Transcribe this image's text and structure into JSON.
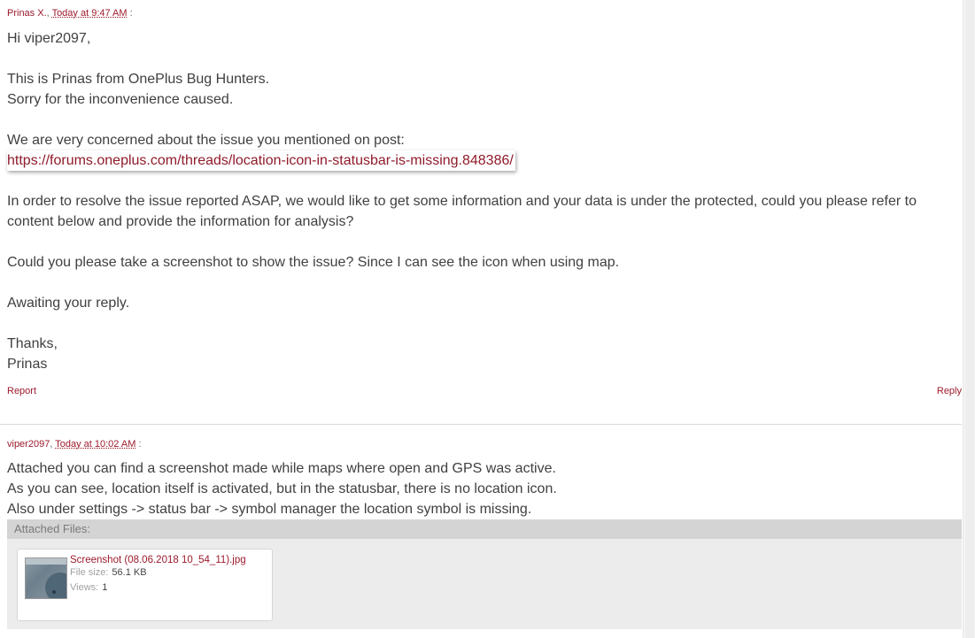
{
  "post1": {
    "author": "Prinas X.",
    "date": "Today at 9:47 AM",
    "sep": ":",
    "greeting": "Hi viper2097,",
    "line_intro_1": "This is Prinas from OnePlus Bug Hunters.",
    "line_intro_2": "Sorry for the inconvenience caused.",
    "line_concern": "We are very concerned about the issue you mentioned on post:",
    "link": "https://forums.oneplus.com/threads/location-icon-in-statusbar-is-missing.848386/",
    "line_resolve_1": "In order to resolve the issue reported ASAP, we would like to get some information and your data is under the protected, could you please refer to",
    "line_resolve_2": "content below and provide the information for analysis?",
    "line_screenshot": "Could you please take a screenshot to show the issue? Since I can see the icon when using map.",
    "line_awaiting": "Awaiting your reply.",
    "line_thanks": "Thanks,",
    "line_signature": "Prinas",
    "report_label": "Report",
    "reply_label": "Reply"
  },
  "post2": {
    "author": "viper2097",
    "date": "Today at 10:02 AM",
    "sep": ":",
    "line_1": "Attached you can find a screenshot made while maps where open and GPS was active.",
    "line_2": "As you can see, location itself is activated, but in the statusbar, there is no location icon.",
    "line_3": "Also under settings -> status bar -> symbol manager the location symbol is missing."
  },
  "attachments": {
    "header": "Attached Files:",
    "file": {
      "name": "Screenshot (08.06.2018 10_54_11).jpg",
      "size_label": "File size:",
      "size_value": "56.1 KB",
      "views_label": "Views:",
      "views_value": "1",
      "thumb_icon": "image-thumbnail-icon"
    }
  },
  "colors": {
    "link": "#8f1b2b",
    "meta": "#9c1a2c",
    "text": "#404040",
    "attach_bg": "#e6e6e6"
  }
}
